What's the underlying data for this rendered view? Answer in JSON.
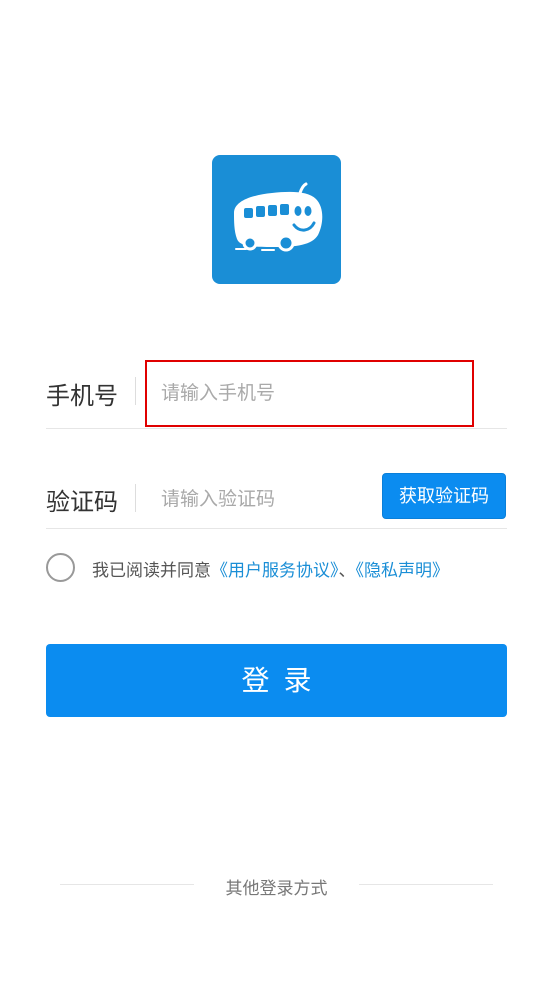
{
  "app": {
    "logo_icon": "bus-icon",
    "brand_color": "#1a8ed6",
    "button_color": "#0b8cf0",
    "highlight_color": "#e00000"
  },
  "phone": {
    "label": "手机号",
    "placeholder": "请输入手机号",
    "value": ""
  },
  "code": {
    "label": "验证码",
    "placeholder": "请输入验证码",
    "value": "",
    "button_label": "获取验证码"
  },
  "agreement": {
    "checked": false,
    "prefix": "我已阅读并同意",
    "terms_link": "《用户服务协议》",
    "separator": "、",
    "privacy_link": "《隐私声明》"
  },
  "login": {
    "button_label": "登录"
  },
  "other_login": {
    "label": "其他登录方式"
  }
}
